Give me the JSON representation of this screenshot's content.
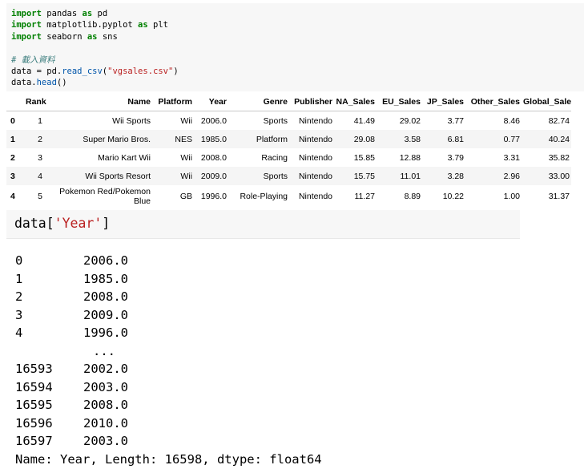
{
  "code_cell": {
    "imports": [
      {
        "kw1": "import",
        "module": " pandas ",
        "kw2": "as",
        "alias": " pd"
      },
      {
        "kw1": "import",
        "module": " matplotlib.pyplot ",
        "kw2": "as",
        "alias": " plt"
      },
      {
        "kw1": "import",
        "module": " seaborn ",
        "kw2": "as",
        "alias": " sns"
      }
    ],
    "comment": "# 載入資料",
    "read_line": {
      "prefix": "data = pd.",
      "fn": "read_csv",
      "open": "(",
      "arg": "\"vgsales.csv\"",
      "close": ")"
    },
    "head_line": {
      "prefix": "data.",
      "fn": "head",
      "call": "()"
    }
  },
  "dataframe": {
    "columns": [
      "",
      "Rank",
      "Name",
      "Platform",
      "Year",
      "Genre",
      "Publisher",
      "NA_Sales",
      "EU_Sales",
      "JP_Sales",
      "Other_Sales",
      "Global_Sales"
    ],
    "rows": [
      [
        "0",
        "1",
        "Wii Sports",
        "Wii",
        "2006.0",
        "Sports",
        "Nintendo",
        "41.49",
        "29.02",
        "3.77",
        "8.46",
        "82.74"
      ],
      [
        "1",
        "2",
        "Super Mario Bros.",
        "NES",
        "1985.0",
        "Platform",
        "Nintendo",
        "29.08",
        "3.58",
        "6.81",
        "0.77",
        "40.24"
      ],
      [
        "2",
        "3",
        "Mario Kart Wii",
        "Wii",
        "2008.0",
        "Racing",
        "Nintendo",
        "15.85",
        "12.88",
        "3.79",
        "3.31",
        "35.82"
      ],
      [
        "3",
        "4",
        "Wii Sports Resort",
        "Wii",
        "2009.0",
        "Sports",
        "Nintendo",
        "15.75",
        "11.01",
        "3.28",
        "2.96",
        "33.00"
      ],
      [
        "4",
        "5",
        "Pokemon Red/Pokemon Blue",
        "GB",
        "1996.0",
        "Role-Playing",
        "Nintendo",
        "11.27",
        "8.89",
        "10.22",
        "1.00",
        "31.37"
      ]
    ]
  },
  "code_cell_2": {
    "prefix": "data[",
    "key": "'Year'",
    "suffix": "]"
  },
  "series_output": {
    "head": [
      {
        "index": "0",
        "value": "2006.0"
      },
      {
        "index": "1",
        "value": "1985.0"
      },
      {
        "index": "2",
        "value": "2008.0"
      },
      {
        "index": "3",
        "value": "2009.0"
      },
      {
        "index": "4",
        "value": "1996.0"
      }
    ],
    "ellipsis": "...",
    "tail": [
      {
        "index": "16593",
        "value": "2002.0"
      },
      {
        "index": "16594",
        "value": "2003.0"
      },
      {
        "index": "16595",
        "value": "2008.0"
      },
      {
        "index": "16596",
        "value": "2010.0"
      },
      {
        "index": "16597",
        "value": "2003.0"
      }
    ],
    "footer": "Name: Year, Length: 16598, dtype: float64"
  }
}
